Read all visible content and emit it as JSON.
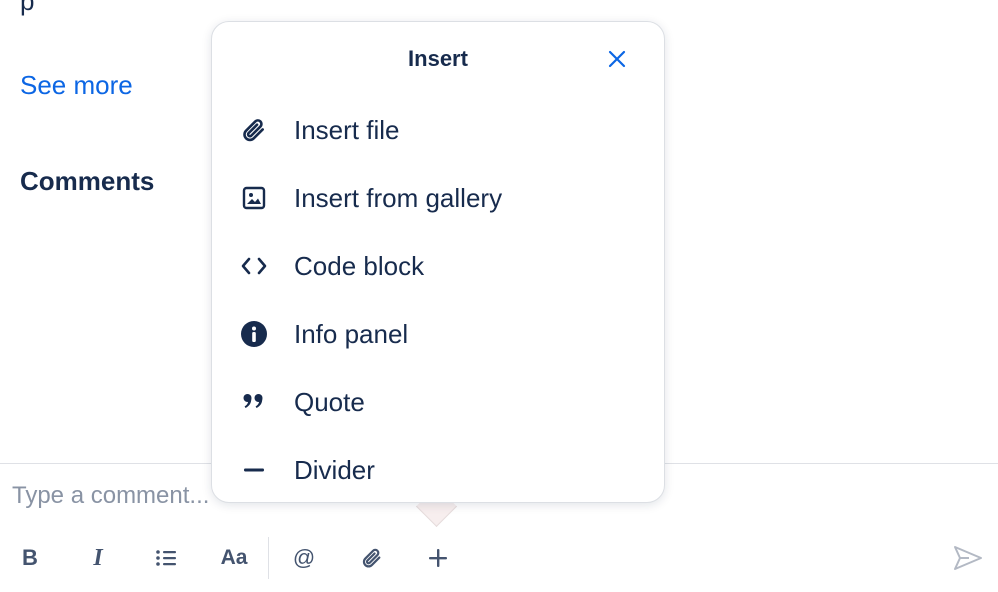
{
  "issue": {
    "see_more_label": "See more",
    "comments_heading": "Comments"
  },
  "composer": {
    "placeholder": "Type a comment...",
    "toolbar": {
      "bold": "B",
      "italic": "I",
      "text_style": "Aa",
      "mention": "@"
    }
  },
  "insert_popup": {
    "title": "Insert",
    "items": [
      {
        "label": "Insert file",
        "icon": "paperclip-icon"
      },
      {
        "label": "Insert from gallery",
        "icon": "image-icon"
      },
      {
        "label": "Code block",
        "icon": "code-icon"
      },
      {
        "label": "Info panel",
        "icon": "info-icon"
      },
      {
        "label": "Quote",
        "icon": "quote-icon"
      },
      {
        "label": "Divider",
        "icon": "divider-icon"
      }
    ]
  },
  "colors": {
    "link": "#0c66e4",
    "text": "#172b4d",
    "muted": "#8993a4",
    "icon": "#44546f"
  }
}
